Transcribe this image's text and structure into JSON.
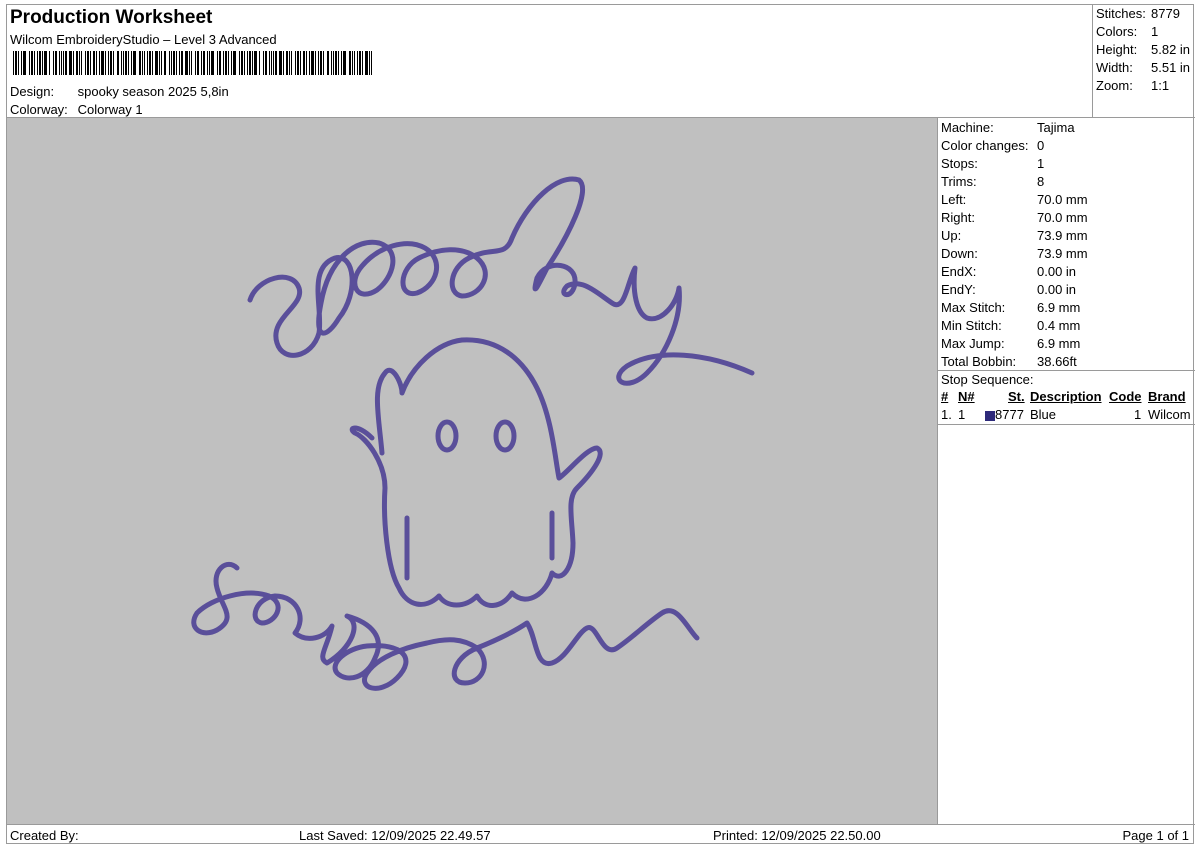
{
  "header": {
    "title": "Production Worksheet",
    "software": "Wilcom EmbroideryStudio – Level 3 Advanced",
    "design_label": "Design:",
    "design_value": "spooky season 2025 5,8in",
    "colorway_label": "Colorway:",
    "colorway_value": "Colorway 1"
  },
  "summary": {
    "stitches_label": "Stitches:",
    "stitches": "8779",
    "colors_label": "Colors:",
    "colors": "1",
    "height_label": "Height:",
    "height": "5.82 in",
    "width_label": "Width:",
    "width": "5.51 in",
    "zoom_label": "Zoom:",
    "zoom": "1:1"
  },
  "machine_info": [
    {
      "label": "Machine:",
      "value": "Tajima"
    },
    {
      "label": "Color changes:",
      "value": "0"
    },
    {
      "label": "Stops:",
      "value": "1"
    },
    {
      "label": "Trims:",
      "value": "8"
    },
    {
      "label": "Left:",
      "value": "70.0 mm"
    },
    {
      "label": "Right:",
      "value": "70.0 mm"
    },
    {
      "label": "Up:",
      "value": "73.9 mm"
    },
    {
      "label": "Down:",
      "value": "73.9 mm"
    },
    {
      "label": "EndX:",
      "value": "0.00 in"
    },
    {
      "label": "EndY:",
      "value": "0.00 in"
    },
    {
      "label": "Max Stitch:",
      "value": "6.9 mm"
    },
    {
      "label": "Min Stitch:",
      "value": "0.4 mm"
    },
    {
      "label": "Max Jump:",
      "value": "6.9 mm"
    },
    {
      "label": "Total Bobbin:",
      "value": "38.66ft"
    }
  ],
  "stop_sequence": {
    "title": "Stop Sequence:",
    "columns": [
      "#",
      "N#",
      "St.",
      "Description",
      "Code",
      "Brand"
    ],
    "rows": [
      {
        "num": "1.",
        "n": "1",
        "st": "8777",
        "description": "Blue",
        "code": "1",
        "brand": "Wilcom",
        "color": "#2e2a7a"
      }
    ]
  },
  "thread_color": "#5a4f9a",
  "footer": {
    "created_by": "Created By:",
    "last_saved": "Last Saved: 12/09/2025 22.49.57",
    "printed": "Printed: 12/09/2025 22.50.00",
    "page": "Page 1 of 1"
  }
}
